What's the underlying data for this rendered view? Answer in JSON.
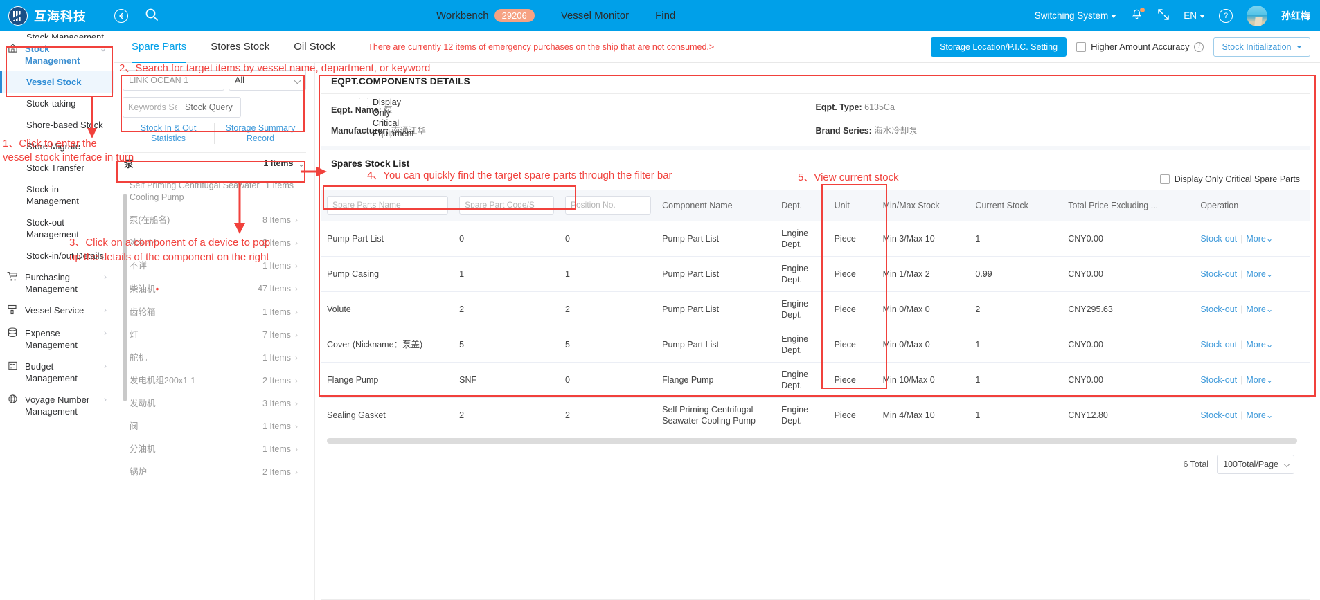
{
  "header": {
    "brand": "互海科技",
    "back_icon": "back-arrow-icon",
    "search_icon": "search-icon",
    "nav": [
      {
        "label": "Workbench",
        "badge": "29206"
      },
      {
        "label": "Vessel Monitor",
        "badge": ""
      },
      {
        "label": "Find",
        "badge": ""
      }
    ],
    "switch_system": "Switching System",
    "language": "EN",
    "username": "孙红梅"
  },
  "sidebar": {
    "truncated_top": "Stock Management",
    "group": {
      "label": "Stock Management",
      "icon": "home-icon"
    },
    "items": [
      {
        "label": "Vessel Stock",
        "active": true
      },
      {
        "label": "Stock-taking",
        "active": false
      },
      {
        "label": "Shore-based Stock",
        "active": false
      },
      {
        "label": "Store Migrate",
        "active": false
      },
      {
        "label": "Stock Transfer",
        "active": false
      },
      {
        "label": "Stock-in Management",
        "active": false
      },
      {
        "label": "Stock-out Management",
        "active": false
      },
      {
        "label": "Stock-in/out Details",
        "active": false
      }
    ],
    "groups": [
      {
        "label": "Purchasing Management",
        "icon": "cart-icon",
        "arrow": "›"
      },
      {
        "label": "Vessel Service",
        "icon": "service-icon",
        "arrow": "›"
      },
      {
        "label": "Expense Management",
        "icon": "database-icon",
        "arrow": "›"
      },
      {
        "label": "Budget Management",
        "icon": "budget-icon",
        "arrow": "›"
      },
      {
        "label": "Voyage Number Management",
        "icon": "globe-icon",
        "arrow": "›"
      }
    ]
  },
  "tabs": {
    "items": [
      {
        "label": "Spare Parts",
        "active": true
      },
      {
        "label": "Stores Stock",
        "active": false
      },
      {
        "label": "Oil Stock",
        "active": false
      }
    ],
    "warning": "There are currently 12 items of emergency purchases on the ship that are not consumed.>",
    "storage_btn": "Storage Location/P.I.C. Setting",
    "higher_amount": "Higher Amount Accuracy",
    "stock_init": "Stock Initialization"
  },
  "filter": {
    "vessel_placeholder": "LINK OCEAN 1",
    "dept_value": "All",
    "keywords_placeholder": "Keywords Se",
    "stock_query_btn": "Stock Query",
    "critical_chk": "Display Only Critical Equipment",
    "links": [
      "Stock In & Out Statistics",
      "Storage Summary Record"
    ]
  },
  "equipment": {
    "header_name": "泵",
    "header_count": "1 Items",
    "list": [
      {
        "name": "Self Priming Centrifugal Seawater Cooling Pump",
        "count": "1 Items",
        "arrow": "",
        "dot": false
      },
      {
        "name": "泵(在船名)",
        "count": "8 Items",
        "arrow": "›",
        "dot": false
      },
      {
        "name": "冰机44",
        "count": "2 Items",
        "arrow": "›",
        "dot": false
      },
      {
        "name": "不详",
        "count": "1 Items",
        "arrow": "›",
        "dot": false
      },
      {
        "name": "柴油机",
        "count": "47 Items",
        "arrow": "›",
        "dot": true
      },
      {
        "name": "齿轮箱",
        "count": "1 Items",
        "arrow": "›",
        "dot": false
      },
      {
        "name": "灯",
        "count": "7 Items",
        "arrow": "›",
        "dot": false
      },
      {
        "name": "舵机",
        "count": "1 Items",
        "arrow": "›",
        "dot": false
      },
      {
        "name": "发电机组200x1-1",
        "count": "2 Items",
        "arrow": "›",
        "dot": false
      },
      {
        "name": "发动机",
        "count": "3 Items",
        "arrow": "›",
        "dot": false
      },
      {
        "name": "阀",
        "count": "1 Items",
        "arrow": "›",
        "dot": false
      },
      {
        "name": "分油机",
        "count": "1 Items",
        "arrow": "›",
        "dot": false
      },
      {
        "name": "锅炉",
        "count": "2 Items",
        "arrow": "›",
        "dot": false
      }
    ]
  },
  "details": {
    "title": "EQPT.COMPONENTS DETAILS",
    "fields": [
      {
        "label": "Eqpt. Name:",
        "value": "泵"
      },
      {
        "label": "Eqpt. Type:",
        "value": "6135Ca"
      },
      {
        "label": "Manufacturer:",
        "value": "南通江华"
      },
      {
        "label": "Brand Series:",
        "value": "海水冷却泵"
      }
    ]
  },
  "spares": {
    "title": "Spares Stock List",
    "critical_chk": "Display Only Critical Spare Parts",
    "filters": {
      "name": "Spare Parts Name",
      "code": "Spare Part Code/S",
      "position": "Position No."
    },
    "columns": [
      "Component Name",
      "Dept.",
      "Unit",
      "Min/Max Stock",
      "Current Stock",
      "Total Price Excluding ...",
      "Operation"
    ],
    "rows": [
      {
        "name": "Pump Part List",
        "code": "0",
        "position": "0",
        "component": "Pump Part List",
        "dept": "Engine Dept.",
        "unit": "Piece",
        "minmax": "Min 3/Max 10",
        "current": "1",
        "current_red": true,
        "price": "CNY0.00",
        "op1": "Stock-out",
        "op2": "More"
      },
      {
        "name": "Pump Casing",
        "code": "1",
        "position": "1",
        "component": "Pump Part List",
        "dept": "Engine Dept.",
        "unit": "Piece",
        "minmax": "Min 1/Max 2",
        "current": "0.99",
        "current_red": true,
        "price": "CNY0.00",
        "op1": "Stock-out",
        "op2": "More"
      },
      {
        "name": "Volute",
        "code": "2",
        "position": "2",
        "component": "Pump Part List",
        "dept": "Engine Dept.",
        "unit": "Piece",
        "minmax": "Min 0/Max 0",
        "current": "2",
        "current_red": false,
        "price": "CNY295.63",
        "op1": "Stock-out",
        "op2": "More"
      },
      {
        "name": "Cover (Nickname：泵盖)",
        "code": "5",
        "position": "5",
        "component": "Pump Part List",
        "dept": "Engine Dept.",
        "unit": "Piece",
        "minmax": "Min 0/Max 0",
        "current": "1",
        "current_red": false,
        "price": "CNY0.00",
        "op1": "Stock-out",
        "op2": "More"
      },
      {
        "name": "Flange Pump",
        "code": "SNF",
        "position": "0",
        "component": "Flange Pump",
        "dept": "Engine Dept.",
        "unit": "Piece",
        "minmax": "Min 10/Max 0",
        "current": "1",
        "current_red": true,
        "price": "CNY0.00",
        "op1": "Stock-out",
        "op2": "More"
      },
      {
        "name": "Sealing Gasket",
        "code": "2",
        "position": "2",
        "component": "Self Priming Centrifugal Seawater Cooling Pump",
        "dept": "Engine Dept.",
        "unit": "Piece",
        "minmax": "Min 4/Max 10",
        "current": "1",
        "current_red": true,
        "price": "CNY12.80",
        "op1": "Stock-out",
        "op2": "More"
      }
    ],
    "total_text": "6 Total",
    "page_size": "100Total/Page"
  },
  "annotations": [
    {
      "id": "a1",
      "text": "1、Click to enter the\nvessel stock interface in turn"
    },
    {
      "id": "a2",
      "text": "2、Search for target items by vessel name, department, or keyword"
    },
    {
      "id": "a3",
      "text": "3、Click on a component of a device to pop\nup the details of the component on the right"
    },
    {
      "id": "a4",
      "text": "4、You can quickly find the target spare parts through the filter bar"
    },
    {
      "id": "a5",
      "text": "5、View current stock"
    }
  ]
}
